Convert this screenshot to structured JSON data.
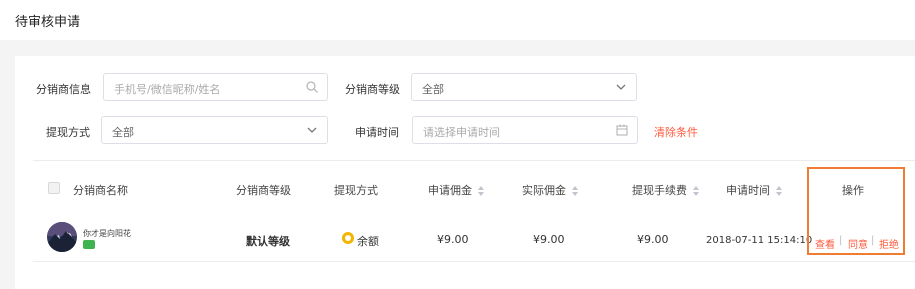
{
  "page": {
    "title": "待审核申请"
  },
  "filters": {
    "distributor_info": {
      "label": "分销商信息",
      "placeholder": "手机号/微信昵称/姓名",
      "icon": "search-icon"
    },
    "distributor_level": {
      "label": "分销商等级",
      "value": "全部",
      "icon": "chevron-down-icon"
    },
    "withdraw_method": {
      "label": "提现方式",
      "value": "全部",
      "icon": "chevron-down-icon"
    },
    "apply_time": {
      "label": "申请时间",
      "placeholder": "请选择申请时间",
      "icon": "calendar-icon"
    },
    "clear_label": "清除条件"
  },
  "table": {
    "headers": {
      "name": "分销商名称",
      "level": "分销商等级",
      "method": "提现方式",
      "commission": "申请佣金",
      "actual": "实际佣金",
      "fee": "提现手续费",
      "time": "申请时间",
      "actions": "操作"
    },
    "rows": [
      {
        "name": "你才是向阳花",
        "level": "默认等级",
        "method": "余额",
        "commission": "¥9.00",
        "actual": "¥9.00",
        "fee": "¥9.00",
        "time": "2018-07-11 15:14:10",
        "actions": {
          "view": "查看",
          "approve": "同意",
          "reject": "拒绝",
          "separator": "|"
        }
      }
    ]
  },
  "colors": {
    "accent": "#ff5a3c",
    "highlight_border": "#f07b33",
    "wechat": "#3fb34f",
    "balance": "#f5b400"
  }
}
